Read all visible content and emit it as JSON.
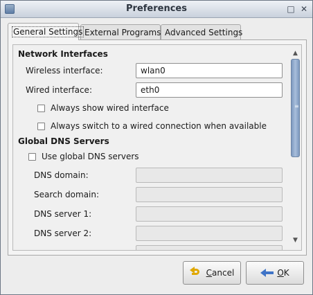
{
  "window": {
    "title": "Preferences"
  },
  "tabs": [
    {
      "label": "General Settings",
      "active": true
    },
    {
      "label": "External Programs",
      "active": false
    },
    {
      "label": "Advanced Settings",
      "active": false
    }
  ],
  "network": {
    "heading": "Network Interfaces",
    "wireless_label": "Wireless interface:",
    "wireless_value": "wlan0",
    "wired_label": "Wired interface:",
    "wired_value": "eth0",
    "always_show_wired": {
      "label": "Always show wired interface",
      "checked": false
    },
    "always_switch_wired": {
      "label": "Always switch to a wired connection when available",
      "checked": false
    }
  },
  "dns": {
    "heading": "Global DNS Servers",
    "use_global": {
      "label": "Use global DNS servers",
      "checked": false
    },
    "domain_label": "DNS domain:",
    "search_label": "Search domain:",
    "server1_label": "DNS server 1:",
    "server2_label": "DNS server 2:"
  },
  "buttons": {
    "cancel_prefix": "",
    "cancel_mnemonic": "C",
    "cancel_rest": "ancel",
    "ok_prefix": "",
    "ok_mnemonic": "O",
    "ok_rest": "K"
  },
  "icons": {
    "cancel": "undo-arrow-icon",
    "ok": "left-arrow-icon",
    "maximize": "maximize-icon",
    "close": "close-icon"
  }
}
